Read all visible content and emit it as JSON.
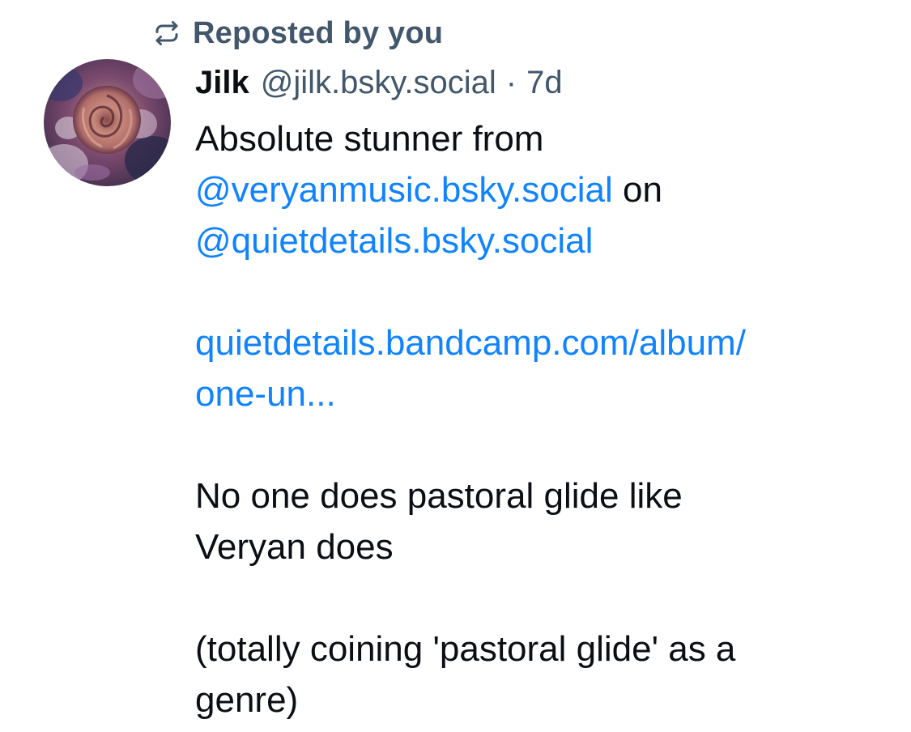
{
  "repost_banner": {
    "icon": "repost-icon",
    "label": "Reposted by you"
  },
  "post": {
    "author": {
      "display_name": "Jilk",
      "handle": "@jilk.bsky.social"
    },
    "separator": "·",
    "timestamp": "7d",
    "body": {
      "line1": "Absolute stunner from",
      "mention1": "@veryanmusic.bsky.social",
      "on_word": " on",
      "mention2": "@quietdetails.bsky.social",
      "link_line1": "quietdetails.bandcamp.com/album/",
      "link_line2": "one-un...",
      "para2_line1": "No one does pastoral glide like",
      "para2_line2": "Veryan does",
      "para3_line1": "(totally coining 'pastoral glide' as a",
      "para3_line2": "genre)"
    }
  },
  "colors": {
    "secondary_text": "#42576c",
    "link": "#1083fe",
    "primary_text": "#0b0f14"
  }
}
